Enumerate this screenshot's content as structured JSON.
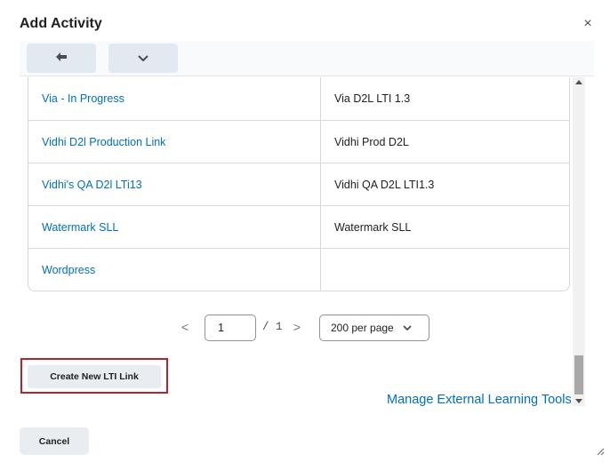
{
  "dialog": {
    "title": "Add Activity",
    "close_symbol": "×"
  },
  "toolbar": {
    "back_icon": "arrow-left-icon",
    "menu_icon": "chevron-down-icon"
  },
  "table": {
    "rows": [
      {
        "name": "Via - In Progress",
        "value": "Via D2L LTI 1.3"
      },
      {
        "name": "Vidhi D2l Production Link",
        "value": "Vidhi Prod D2L"
      },
      {
        "name": "Vidhi's QA D2l LTi13",
        "value": "Vidhi QA D2L LTI1.3"
      },
      {
        "name": "Watermark SLL",
        "value": "Watermark SLL"
      },
      {
        "name": "Wordpress",
        "value": ""
      }
    ]
  },
  "pagination": {
    "prev_symbol": "<",
    "page": "1",
    "total": "/ 1",
    "next_symbol": ">",
    "per_page": "200 per page"
  },
  "actions": {
    "create_label": "Create New LTI Link",
    "manage_label": "Manage External Learning Tools",
    "cancel_label": "Cancel"
  },
  "colors": {
    "link": "#006fbf",
    "highlight_border": "#b2242e",
    "button_bg": "#e9ecf0"
  }
}
